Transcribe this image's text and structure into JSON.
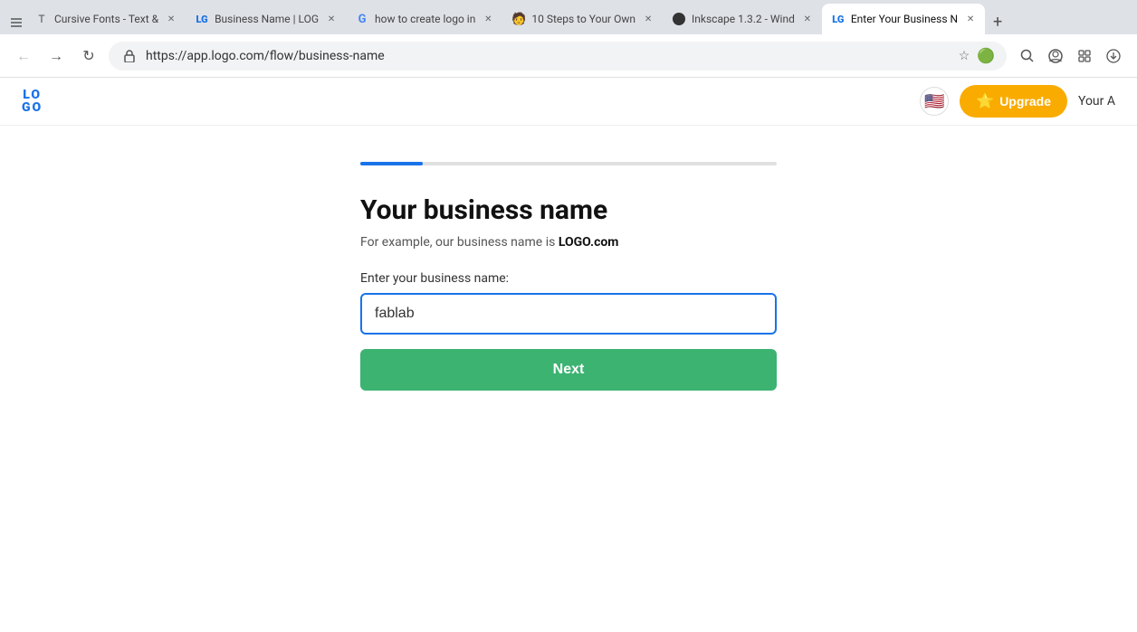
{
  "browser": {
    "tabs": [
      {
        "id": "tab1",
        "title": "Cursive Fonts - Text &",
        "active": false,
        "favicon": "T"
      },
      {
        "id": "tab2",
        "title": "Business Name | LOG",
        "active": false,
        "favicon": "logo"
      },
      {
        "id": "tab3",
        "title": "how to create logo in",
        "active": false,
        "favicon": "G"
      },
      {
        "id": "tab4",
        "title": "10 Steps to Your Own",
        "active": false,
        "favicon": "🧑"
      },
      {
        "id": "tab5",
        "title": "Inkscape 1.3.2 - Wind",
        "active": false,
        "favicon": "ink"
      },
      {
        "id": "tab6",
        "title": "Enter Your Business N",
        "active": true,
        "favicon": "logo"
      }
    ],
    "address": "https://app.logo.com/flow/business-name",
    "new_tab_label": "+"
  },
  "header": {
    "logo_top": "LO",
    "logo_bottom": "GO",
    "flag_emoji": "🇺🇸",
    "upgrade_label": "Upgrade",
    "upgrade_icon": "⭐",
    "account_label": "Your A"
  },
  "page": {
    "progress_percent": 15,
    "title": "Your business name",
    "subtitle_prefix": "For example, our business name is ",
    "subtitle_brand": "LOGO.com",
    "input_label": "Enter your business name:",
    "input_placeholder": "Enter your business name:",
    "input_value": "fablab",
    "next_button_label": "Next"
  }
}
